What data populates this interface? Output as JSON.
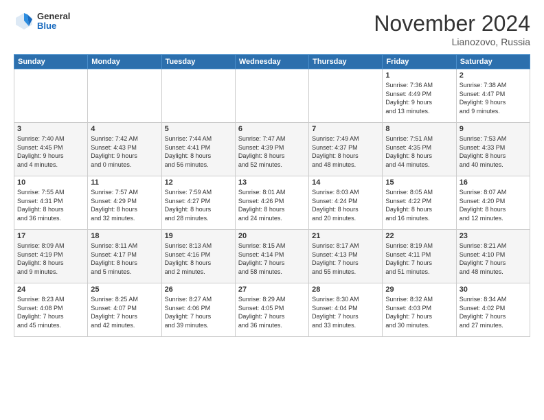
{
  "logo": {
    "general": "General",
    "blue": "Blue"
  },
  "title": "November 2024",
  "location": "Lianozovo, Russia",
  "days_header": [
    "Sunday",
    "Monday",
    "Tuesday",
    "Wednesday",
    "Thursday",
    "Friday",
    "Saturday"
  ],
  "weeks": [
    [
      {
        "day": "",
        "info": ""
      },
      {
        "day": "",
        "info": ""
      },
      {
        "day": "",
        "info": ""
      },
      {
        "day": "",
        "info": ""
      },
      {
        "day": "",
        "info": ""
      },
      {
        "day": "1",
        "info": "Sunrise: 7:36 AM\nSunset: 4:49 PM\nDaylight: 9 hours\nand 13 minutes."
      },
      {
        "day": "2",
        "info": "Sunrise: 7:38 AM\nSunset: 4:47 PM\nDaylight: 9 hours\nand 9 minutes."
      }
    ],
    [
      {
        "day": "3",
        "info": "Sunrise: 7:40 AM\nSunset: 4:45 PM\nDaylight: 9 hours\nand 4 minutes."
      },
      {
        "day": "4",
        "info": "Sunrise: 7:42 AM\nSunset: 4:43 PM\nDaylight: 9 hours\nand 0 minutes."
      },
      {
        "day": "5",
        "info": "Sunrise: 7:44 AM\nSunset: 4:41 PM\nDaylight: 8 hours\nand 56 minutes."
      },
      {
        "day": "6",
        "info": "Sunrise: 7:47 AM\nSunset: 4:39 PM\nDaylight: 8 hours\nand 52 minutes."
      },
      {
        "day": "7",
        "info": "Sunrise: 7:49 AM\nSunset: 4:37 PM\nDaylight: 8 hours\nand 48 minutes."
      },
      {
        "day": "8",
        "info": "Sunrise: 7:51 AM\nSunset: 4:35 PM\nDaylight: 8 hours\nand 44 minutes."
      },
      {
        "day": "9",
        "info": "Sunrise: 7:53 AM\nSunset: 4:33 PM\nDaylight: 8 hours\nand 40 minutes."
      }
    ],
    [
      {
        "day": "10",
        "info": "Sunrise: 7:55 AM\nSunset: 4:31 PM\nDaylight: 8 hours\nand 36 minutes."
      },
      {
        "day": "11",
        "info": "Sunrise: 7:57 AM\nSunset: 4:29 PM\nDaylight: 8 hours\nand 32 minutes."
      },
      {
        "day": "12",
        "info": "Sunrise: 7:59 AM\nSunset: 4:27 PM\nDaylight: 8 hours\nand 28 minutes."
      },
      {
        "day": "13",
        "info": "Sunrise: 8:01 AM\nSunset: 4:26 PM\nDaylight: 8 hours\nand 24 minutes."
      },
      {
        "day": "14",
        "info": "Sunrise: 8:03 AM\nSunset: 4:24 PM\nDaylight: 8 hours\nand 20 minutes."
      },
      {
        "day": "15",
        "info": "Sunrise: 8:05 AM\nSunset: 4:22 PM\nDaylight: 8 hours\nand 16 minutes."
      },
      {
        "day": "16",
        "info": "Sunrise: 8:07 AM\nSunset: 4:20 PM\nDaylight: 8 hours\nand 12 minutes."
      }
    ],
    [
      {
        "day": "17",
        "info": "Sunrise: 8:09 AM\nSunset: 4:19 PM\nDaylight: 8 hours\nand 9 minutes."
      },
      {
        "day": "18",
        "info": "Sunrise: 8:11 AM\nSunset: 4:17 PM\nDaylight: 8 hours\nand 5 minutes."
      },
      {
        "day": "19",
        "info": "Sunrise: 8:13 AM\nSunset: 4:16 PM\nDaylight: 8 hours\nand 2 minutes."
      },
      {
        "day": "20",
        "info": "Sunrise: 8:15 AM\nSunset: 4:14 PM\nDaylight: 7 hours\nand 58 minutes."
      },
      {
        "day": "21",
        "info": "Sunrise: 8:17 AM\nSunset: 4:13 PM\nDaylight: 7 hours\nand 55 minutes."
      },
      {
        "day": "22",
        "info": "Sunrise: 8:19 AM\nSunset: 4:11 PM\nDaylight: 7 hours\nand 51 minutes."
      },
      {
        "day": "23",
        "info": "Sunrise: 8:21 AM\nSunset: 4:10 PM\nDaylight: 7 hours\nand 48 minutes."
      }
    ],
    [
      {
        "day": "24",
        "info": "Sunrise: 8:23 AM\nSunset: 4:08 PM\nDaylight: 7 hours\nand 45 minutes."
      },
      {
        "day": "25",
        "info": "Sunrise: 8:25 AM\nSunset: 4:07 PM\nDaylight: 7 hours\nand 42 minutes."
      },
      {
        "day": "26",
        "info": "Sunrise: 8:27 AM\nSunset: 4:06 PM\nDaylight: 7 hours\nand 39 minutes."
      },
      {
        "day": "27",
        "info": "Sunrise: 8:29 AM\nSunset: 4:05 PM\nDaylight: 7 hours\nand 36 minutes."
      },
      {
        "day": "28",
        "info": "Sunrise: 8:30 AM\nSunset: 4:04 PM\nDaylight: 7 hours\nand 33 minutes."
      },
      {
        "day": "29",
        "info": "Sunrise: 8:32 AM\nSunset: 4:03 PM\nDaylight: 7 hours\nand 30 minutes."
      },
      {
        "day": "30",
        "info": "Sunrise: 8:34 AM\nSunset: 4:02 PM\nDaylight: 7 hours\nand 27 minutes."
      }
    ]
  ]
}
